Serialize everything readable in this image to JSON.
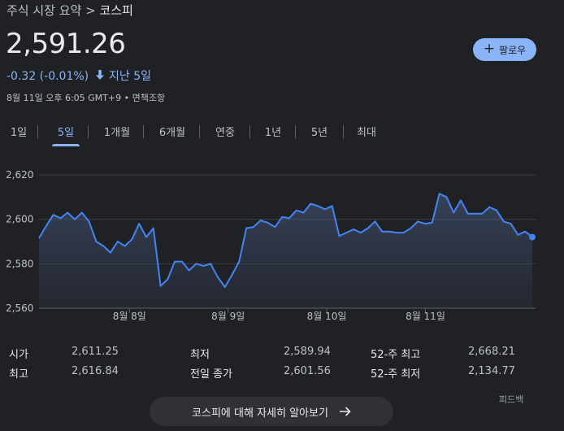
{
  "breadcrumb": {
    "parent": "주식 시장 요약",
    "separator": ">",
    "current": "코스피"
  },
  "price": "2,591.26",
  "change": {
    "text": "-0.32 (-0.01%)",
    "period": "지난 5일",
    "color": "#8ab4f8"
  },
  "meta": "8월 11일 오후 6:05 GMT+9 • 면책조항",
  "follow_button": {
    "label": "팔로우",
    "icon": "plus-icon"
  },
  "tabs": [
    {
      "label": "1일",
      "active": false
    },
    {
      "label": "5일",
      "active": true
    },
    {
      "label": "1개월",
      "active": false
    },
    {
      "label": "6개월",
      "active": false
    },
    {
      "label": "연중",
      "active": false
    },
    {
      "label": "1년",
      "active": false
    },
    {
      "label": "5년",
      "active": false
    },
    {
      "label": "최대",
      "active": false
    }
  ],
  "chart_data": {
    "type": "area",
    "ylim": [
      2560,
      2620
    ],
    "yticks": [
      {
        "v": 2620,
        "label": "2,620"
      },
      {
        "v": 2600,
        "label": "2,600"
      },
      {
        "v": 2580,
        "label": "2,580"
      },
      {
        "v": 2560,
        "label": "2,560"
      }
    ],
    "x_tick_labels": [
      {
        "x": 11,
        "label": "8월 8일"
      },
      {
        "x": 23,
        "label": "8월 9일"
      },
      {
        "x": 35,
        "label": "8월 10일"
      },
      {
        "x": 47,
        "label": "8월 11일"
      }
    ],
    "xlim": [
      0,
      60
    ],
    "grid": true,
    "line_color": "#4285f4",
    "values": [
      2591.5,
      2597,
      2602,
      2600.5,
      2603,
      2600,
      2603,
      2599,
      2590,
      2588,
      2585,
      2590,
      2588,
      2591,
      2598,
      2592,
      2596,
      2570,
      2573,
      2581,
      2581,
      2577,
      2580,
      2579,
      2580,
      2574,
      2569.5,
      2575,
      2581,
      2596,
      2596.5,
      2599.5,
      2598.5,
      2596.5,
      2601,
      2600.5,
      2604,
      2603,
      2607,
      2606,
      2604.5,
      2606,
      2592.5,
      2594,
      2595.5,
      2594,
      2596,
      2599,
      2594.5,
      2594.5,
      2594,
      2594,
      2596,
      2599,
      2598,
      2598.5,
      2611.5,
      2610,
      2603,
      2608.5,
      2602.5,
      2602.5,
      2602.5,
      2605.5,
      2604,
      2599,
      2598,
      2593,
      2594.5,
      2592
    ]
  },
  "stats": [
    {
      "label": "시가",
      "value": "2,611.25"
    },
    {
      "label": "최고",
      "value": "2,616.84"
    },
    {
      "label": "최저",
      "value": "2,589.94"
    },
    {
      "label": "전일 종가",
      "value": "2,601.56"
    },
    {
      "label": "52-주 최고",
      "value": "2,668.21"
    },
    {
      "label": "52-주 최저",
      "value": "2,134.77"
    }
  ],
  "feedback": "피드백",
  "more_button": {
    "label": "코스피에 대해 자세히 알아보기",
    "icon": "arrow-right-icon"
  }
}
